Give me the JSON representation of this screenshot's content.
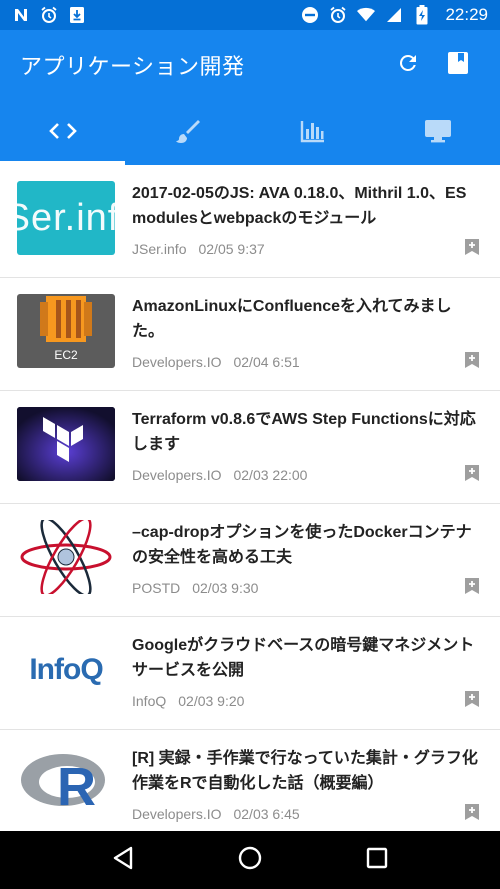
{
  "status_bar": {
    "time": "22:29",
    "left_icons": [
      "notification-n-icon",
      "alarm-icon",
      "download-icon"
    ],
    "right_icons": [
      "do-not-disturb-icon",
      "alarm-icon",
      "wifi-icon",
      "signal-icon",
      "battery-charging-icon"
    ]
  },
  "app_bar": {
    "title": "アプリケーション開発",
    "actions": [
      "refresh-icon",
      "bookmarks-icon"
    ]
  },
  "tabs": [
    {
      "icon": "code-icon",
      "active": true
    },
    {
      "icon": "brush-icon",
      "active": false
    },
    {
      "icon": "bar-chart-icon",
      "active": false
    },
    {
      "icon": "desktop-icon",
      "active": false
    }
  ],
  "articles": [
    {
      "title": "2017-02-05のJS: AVA 0.18.0、Mithril 1.0、ES modulesとwebpackのモジュール",
      "source": "JSer.info",
      "date": "02/05 9:37",
      "thumb": "jser",
      "thumb_text": "Ser.inf"
    },
    {
      "title": "AmazonLinuxにConfluenceを入れてみました。",
      "source": "Developers.IO",
      "date": "02/04 6:51",
      "thumb": "ec2",
      "thumb_text": "EC2"
    },
    {
      "title": "Terraform v0.8.6でAWS Step Functionsに対応します",
      "source": "Developers.IO",
      "date": "02/03 22:00",
      "thumb": "terraform",
      "thumb_text": ""
    },
    {
      "title": "–cap-dropオプションを使ったDockerコンテナの安全性を高める工夫",
      "source": "POSTD",
      "date": "02/03 9:30",
      "thumb": "atom",
      "thumb_text": ""
    },
    {
      "title": "Googleがクラウドベースの暗号鍵マネジメントサービスを公開",
      "source": "InfoQ",
      "date": "02/03 9:20",
      "thumb": "infoq",
      "thumb_text": "InfoQ"
    },
    {
      "title": "[R] 実録・手作業で行なっていた集計・グラフ化作業をRで自動化した話（概要編）",
      "source": "Developers.IO",
      "date": "02/03 6:45",
      "thumb": "r",
      "thumb_text": "R"
    }
  ],
  "colors": {
    "status_bar": "#0570D6",
    "primary": "#1685EE",
    "meta_text": "#8c8c8c"
  }
}
